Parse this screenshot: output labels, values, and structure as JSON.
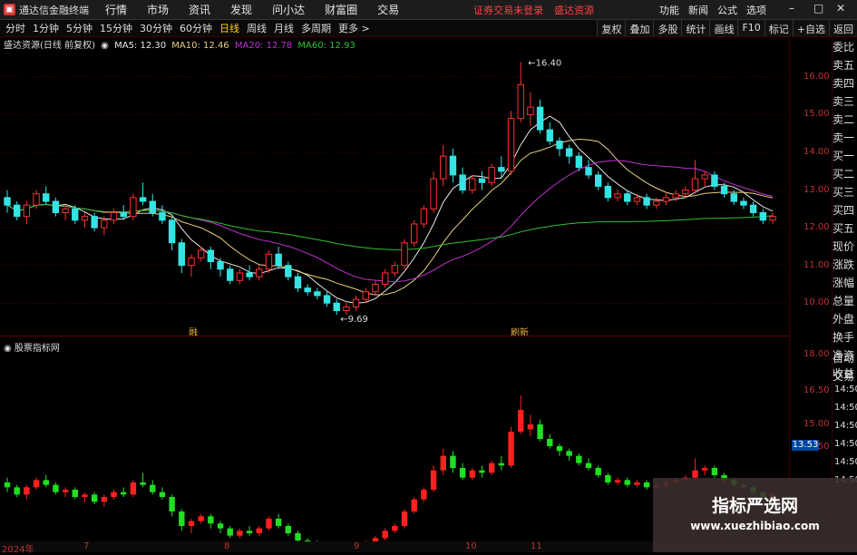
{
  "app": {
    "title": "通达信金融终端",
    "menu": [
      "行情",
      "市场",
      "资讯",
      "发现",
      "问小达",
      "财富圈",
      "交易"
    ],
    "notice1": "证券交易未登录",
    "notice2": "盛达资源",
    "right_menu": [
      "功能",
      "新闻",
      "公式",
      "选项"
    ],
    "win": {
      "min": "–",
      "max": "□",
      "close": "✕"
    }
  },
  "periods": {
    "items": [
      "分时",
      "1分钟",
      "5分钟",
      "15分钟",
      "30分钟",
      "60分钟",
      "日线",
      "周线",
      "月线",
      "多周期",
      "更多 >"
    ],
    "active": 6
  },
  "toolbar": [
    "复权",
    "叠加",
    "多股",
    "统计",
    "画线",
    "F10",
    "标记",
    "+自选",
    "返回"
  ],
  "legend": {
    "stock": "盛达资源(日线 前复权)",
    "ma5": "MA5: 12.30",
    "ma10": "MA10: 12.46",
    "ma20": "MA20: 12.78",
    "ma60": "MA60: 12.93"
  },
  "sub_legend": "股票指标网",
  "right_col": [
    "委比",
    "卖五",
    "卖四",
    "卖三",
    "卖二",
    "卖一",
    "买一",
    "买二",
    "买三",
    "买四",
    "买五",
    "现价",
    "涨跌",
    "涨幅",
    "总量",
    "外盘",
    "换手",
    "净资",
    "收益"
  ],
  "right_col2": [
    "自动",
    "交易"
  ],
  "price_axis": [
    "16.00",
    "15.00",
    "14.00",
    "13.00",
    "12.00",
    "11.00",
    "10.00"
  ],
  "sub_axis": [
    "18.00",
    "16.50",
    "15.00",
    "13.50"
  ],
  "time_axis": [
    "14:50",
    "14:50",
    "14:50",
    "14:50",
    "14:50",
    "14:50"
  ],
  "price_tag": "13.53",
  "hi_label": "16.40",
  "lo_label": "9.69",
  "marker_labels": [
    "融",
    "刷新"
  ],
  "date_axis": [
    "2024年",
    "7",
    "8",
    "9",
    "10",
    "11"
  ],
  "watermark": {
    "line1": "指标严选网",
    "line2": "www.xuezhibiao.com"
  },
  "colors": {
    "up": "#ff3030",
    "down": "#35e3e3",
    "ma5": "#e8e8e8",
    "ma10": "#e8d080",
    "ma20": "#c030d0",
    "ma60": "#30c030"
  },
  "chart_data": {
    "type": "candlestick",
    "ylim": [
      9.5,
      16.6
    ],
    "candles": [
      [
        12.8,
        13.0,
        12.4,
        12.6
      ],
      [
        12.6,
        12.7,
        12.2,
        12.3
      ],
      [
        12.3,
        12.7,
        12.1,
        12.6
      ],
      [
        12.6,
        13.0,
        12.5,
        12.9
      ],
      [
        12.9,
        13.1,
        12.6,
        12.7
      ],
      [
        12.7,
        12.8,
        12.3,
        12.4
      ],
      [
        12.4,
        12.6,
        12.2,
        12.5
      ],
      [
        12.5,
        12.6,
        12.1,
        12.2
      ],
      [
        12.2,
        12.4,
        12.0,
        12.3
      ],
      [
        12.3,
        12.4,
        11.9,
        12.0
      ],
      [
        12.0,
        12.3,
        11.8,
        12.2
      ],
      [
        12.2,
        12.5,
        12.1,
        12.4
      ],
      [
        12.4,
        12.6,
        12.2,
        12.3
      ],
      [
        12.3,
        12.9,
        12.2,
        12.8
      ],
      [
        12.8,
        13.2,
        12.6,
        12.7
      ],
      [
        12.7,
        12.9,
        12.3,
        12.4
      ],
      [
        12.4,
        12.6,
        12.1,
        12.2
      ],
      [
        12.2,
        12.3,
        11.4,
        11.6
      ],
      [
        11.6,
        11.7,
        10.8,
        11.0
      ],
      [
        11.0,
        11.3,
        10.7,
        11.2
      ],
      [
        11.2,
        11.5,
        11.1,
        11.4
      ],
      [
        11.4,
        11.5,
        10.9,
        11.1
      ],
      [
        11.1,
        11.2,
        10.7,
        10.9
      ],
      [
        10.9,
        11.0,
        10.5,
        10.6
      ],
      [
        10.6,
        10.9,
        10.5,
        10.8
      ],
      [
        10.8,
        11.0,
        10.6,
        10.7
      ],
      [
        10.7,
        11.0,
        10.6,
        10.9
      ],
      [
        10.9,
        11.4,
        10.8,
        11.3
      ],
      [
        11.3,
        11.5,
        10.9,
        11.0
      ],
      [
        11.0,
        11.1,
        10.6,
        10.7
      ],
      [
        10.7,
        10.8,
        10.3,
        10.4
      ],
      [
        10.4,
        10.5,
        10.2,
        10.3
      ],
      [
        10.3,
        10.4,
        10.1,
        10.2
      ],
      [
        10.2,
        10.3,
        9.9,
        10.0
      ],
      [
        10.0,
        10.1,
        9.69,
        9.8
      ],
      [
        9.8,
        10.0,
        9.7,
        9.9
      ],
      [
        9.9,
        10.2,
        9.8,
        10.1
      ],
      [
        10.1,
        10.4,
        10.0,
        10.3
      ],
      [
        10.3,
        10.6,
        10.2,
        10.5
      ],
      [
        10.5,
        10.9,
        10.4,
        10.8
      ],
      [
        10.8,
        11.1,
        10.7,
        11.0
      ],
      [
        11.0,
        11.7,
        10.9,
        11.6
      ],
      [
        11.6,
        12.2,
        11.5,
        12.1
      ],
      [
        12.1,
        12.6,
        12.0,
        12.5
      ],
      [
        12.5,
        13.5,
        12.4,
        13.3
      ],
      [
        13.3,
        14.2,
        13.1,
        13.9
      ],
      [
        13.9,
        14.1,
        13.2,
        13.4
      ],
      [
        13.4,
        13.6,
        12.9,
        13.0
      ],
      [
        13.0,
        13.4,
        12.9,
        13.3
      ],
      [
        13.3,
        13.5,
        13.0,
        13.2
      ],
      [
        13.2,
        13.7,
        13.1,
        13.6
      ],
      [
        13.6,
        13.9,
        13.3,
        13.5
      ],
      [
        13.5,
        15.1,
        13.4,
        14.9
      ],
      [
        14.9,
        16.4,
        14.8,
        15.8
      ],
      [
        15.0,
        15.6,
        14.7,
        15.2
      ],
      [
        15.2,
        15.4,
        14.5,
        14.6
      ],
      [
        14.6,
        14.8,
        14.2,
        14.3
      ],
      [
        14.3,
        14.4,
        13.9,
        14.1
      ],
      [
        14.1,
        14.2,
        13.7,
        13.9
      ],
      [
        13.9,
        14.0,
        13.5,
        13.6
      ],
      [
        13.6,
        13.8,
        13.3,
        13.4
      ],
      [
        13.4,
        13.5,
        13.0,
        13.1
      ],
      [
        13.1,
        13.2,
        12.7,
        12.8
      ],
      [
        12.8,
        13.0,
        12.7,
        12.9
      ],
      [
        12.9,
        13.0,
        12.6,
        12.7
      ],
      [
        12.7,
        12.9,
        12.6,
        12.8
      ],
      [
        12.8,
        12.9,
        12.5,
        12.6
      ],
      [
        12.6,
        12.8,
        12.5,
        12.7
      ],
      [
        12.7,
        12.9,
        12.6,
        12.8
      ],
      [
        12.8,
        13.0,
        12.7,
        12.9
      ],
      [
        12.9,
        13.1,
        12.8,
        13.0
      ],
      [
        13.0,
        13.8,
        12.9,
        13.3
      ],
      [
        13.3,
        13.5,
        13.1,
        13.4
      ],
      [
        13.4,
        13.5,
        13.0,
        13.1
      ],
      [
        13.1,
        13.2,
        12.8,
        12.9
      ],
      [
        12.9,
        13.0,
        12.6,
        12.7
      ],
      [
        12.7,
        12.8,
        12.5,
        12.6
      ],
      [
        12.6,
        12.7,
        12.3,
        12.4
      ],
      [
        12.4,
        12.5,
        12.1,
        12.2
      ],
      [
        12.2,
        12.4,
        12.1,
        12.3
      ]
    ]
  }
}
